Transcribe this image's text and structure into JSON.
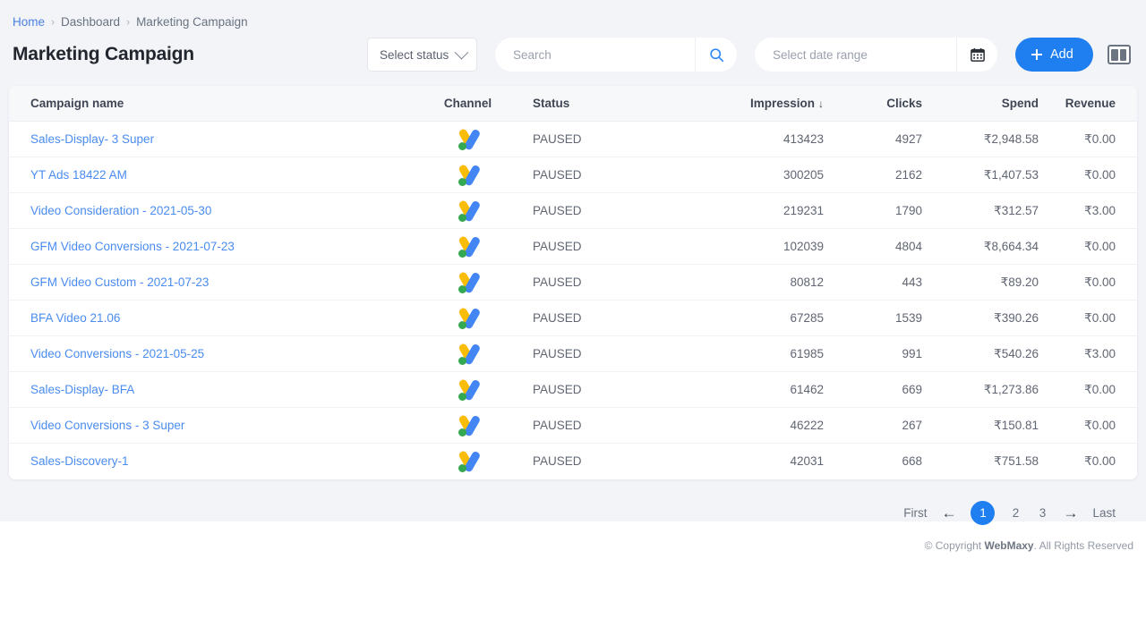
{
  "breadcrumb": {
    "items": [
      {
        "label": "Home",
        "type": "link"
      },
      {
        "label": "Dashboard",
        "type": "plain"
      },
      {
        "label": "Marketing Campaign",
        "type": "plain"
      }
    ],
    "separator": "›"
  },
  "header": {
    "title": "Marketing Campaign"
  },
  "toolbar": {
    "status_filter": {
      "value": "Select status",
      "icon": "chevron-down-icon"
    },
    "search": {
      "value": "",
      "placeholder": "Search",
      "icon": "search-icon"
    },
    "date_range": {
      "value": "",
      "placeholder": "Select date range",
      "icon": "calendar-icon"
    },
    "add_button": {
      "label": "Add",
      "icon": "plus-icon",
      "color": "#1f7ef0"
    },
    "columns_button": {
      "icon": "columns-icon"
    }
  },
  "table": {
    "columns": [
      {
        "label": "Campaign name",
        "align": "left"
      },
      {
        "label": "Channel",
        "align": "center"
      },
      {
        "label": "Status",
        "align": "left"
      },
      {
        "label": "Impression",
        "align": "right",
        "sort": "↓"
      },
      {
        "label": "Clicks",
        "align": "right"
      },
      {
        "label": "Spend",
        "align": "right"
      },
      {
        "label": "Revenue",
        "align": "right"
      }
    ],
    "rows": [
      {
        "name": "Sales-Display- 3 Super",
        "channel": "google-ads-icon",
        "status": "PAUSED",
        "impression": "413423",
        "clicks": "4927",
        "spend": "₹2,948.58",
        "revenue": "₹0.00"
      },
      {
        "name": "YT Ads 18422 AM",
        "channel": "google-ads-icon",
        "status": "PAUSED",
        "impression": "300205",
        "clicks": "2162",
        "spend": "₹1,407.53",
        "revenue": "₹0.00"
      },
      {
        "name": "Video Consideration - 2021-05-30",
        "channel": "google-ads-icon",
        "status": "PAUSED",
        "impression": "219231",
        "clicks": "1790",
        "spend": "₹312.57",
        "revenue": "₹3.00"
      },
      {
        "name": "GFM Video Conversions - 2021-07-23",
        "channel": "google-ads-icon",
        "status": "PAUSED",
        "impression": "102039",
        "clicks": "4804",
        "spend": "₹8,664.34",
        "revenue": "₹0.00"
      },
      {
        "name": "GFM Video Custom - 2021-07-23",
        "channel": "google-ads-icon",
        "status": "PAUSED",
        "impression": "80812",
        "clicks": "443",
        "spend": "₹89.20",
        "revenue": "₹0.00"
      },
      {
        "name": "BFA Video 21.06",
        "channel": "google-ads-icon",
        "status": "PAUSED",
        "impression": "67285",
        "clicks": "1539",
        "spend": "₹390.26",
        "revenue": "₹0.00"
      },
      {
        "name": "Video Conversions - 2021-05-25",
        "channel": "google-ads-icon",
        "status": "PAUSED",
        "impression": "61985",
        "clicks": "991",
        "spend": "₹540.26",
        "revenue": "₹3.00"
      },
      {
        "name": "Sales-Display- BFA",
        "channel": "google-ads-icon",
        "status": "PAUSED",
        "impression": "61462",
        "clicks": "669",
        "spend": "₹1,273.86",
        "revenue": "₹0.00"
      },
      {
        "name": "Video Conversions - 3 Super",
        "channel": "google-ads-icon",
        "status": "PAUSED",
        "impression": "46222",
        "clicks": "267",
        "spend": "₹150.81",
        "revenue": "₹0.00"
      },
      {
        "name": "Sales-Discovery-1",
        "channel": "google-ads-icon",
        "status": "PAUSED",
        "impression": "42031",
        "clicks": "668",
        "spend": "₹751.58",
        "revenue": "₹0.00"
      }
    ]
  },
  "pagination": {
    "first_label": "First",
    "prev_icon": "←",
    "pages": [
      "1",
      "2",
      "3"
    ],
    "active_page": "1",
    "next_icon": "→",
    "last_label": "Last"
  },
  "footer": {
    "prefix": "© Copyright ",
    "brand": "WebMaxy",
    "suffix": ". All Rights Reserved"
  }
}
